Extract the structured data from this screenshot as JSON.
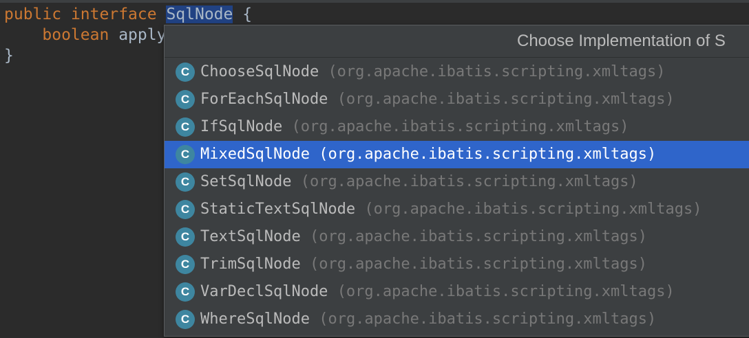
{
  "code": {
    "line1": {
      "kw1": "public",
      "kw2": "interface",
      "selected_name": "SqlNode",
      "brace": "{"
    },
    "line2": {
      "kw": "boolean",
      "method": "apply"
    },
    "line3": {
      "brace": "}"
    }
  },
  "popup": {
    "title": "Choose Implementation of S",
    "items": [
      {
        "icon": "C",
        "name": "ChooseSqlNode",
        "package": "(org.apache.ibatis.scripting.xmltags)",
        "selected": false
      },
      {
        "icon": "C",
        "name": "ForEachSqlNode",
        "package": "(org.apache.ibatis.scripting.xmltags)",
        "selected": false
      },
      {
        "icon": "C",
        "name": "IfSqlNode",
        "package": "(org.apache.ibatis.scripting.xmltags)",
        "selected": false
      },
      {
        "icon": "C",
        "name": "MixedSqlNode",
        "package": "(org.apache.ibatis.scripting.xmltags)",
        "selected": true
      },
      {
        "icon": "C",
        "name": "SetSqlNode",
        "package": "(org.apache.ibatis.scripting.xmltags)",
        "selected": false
      },
      {
        "icon": "C",
        "name": "StaticTextSqlNode",
        "package": "(org.apache.ibatis.scripting.xmltags)",
        "selected": false
      },
      {
        "icon": "C",
        "name": "TextSqlNode",
        "package": "(org.apache.ibatis.scripting.xmltags)",
        "selected": false
      },
      {
        "icon": "C",
        "name": "TrimSqlNode",
        "package": "(org.apache.ibatis.scripting.xmltags)",
        "selected": false
      },
      {
        "icon": "C",
        "name": "VarDeclSqlNode",
        "package": "(org.apache.ibatis.scripting.xmltags)",
        "selected": false
      },
      {
        "icon": "C",
        "name": "WhereSqlNode",
        "package": "(org.apache.ibatis.scripting.xmltags)",
        "selected": false
      }
    ]
  },
  "colors": {
    "editor_bg": "#2b2b2b",
    "keyword": "#cc7832",
    "popup_bg": "#3c3f41",
    "selection": "#2f65ca",
    "class_icon": "#3e86a0"
  },
  "icons": {
    "class": "class-icon"
  }
}
